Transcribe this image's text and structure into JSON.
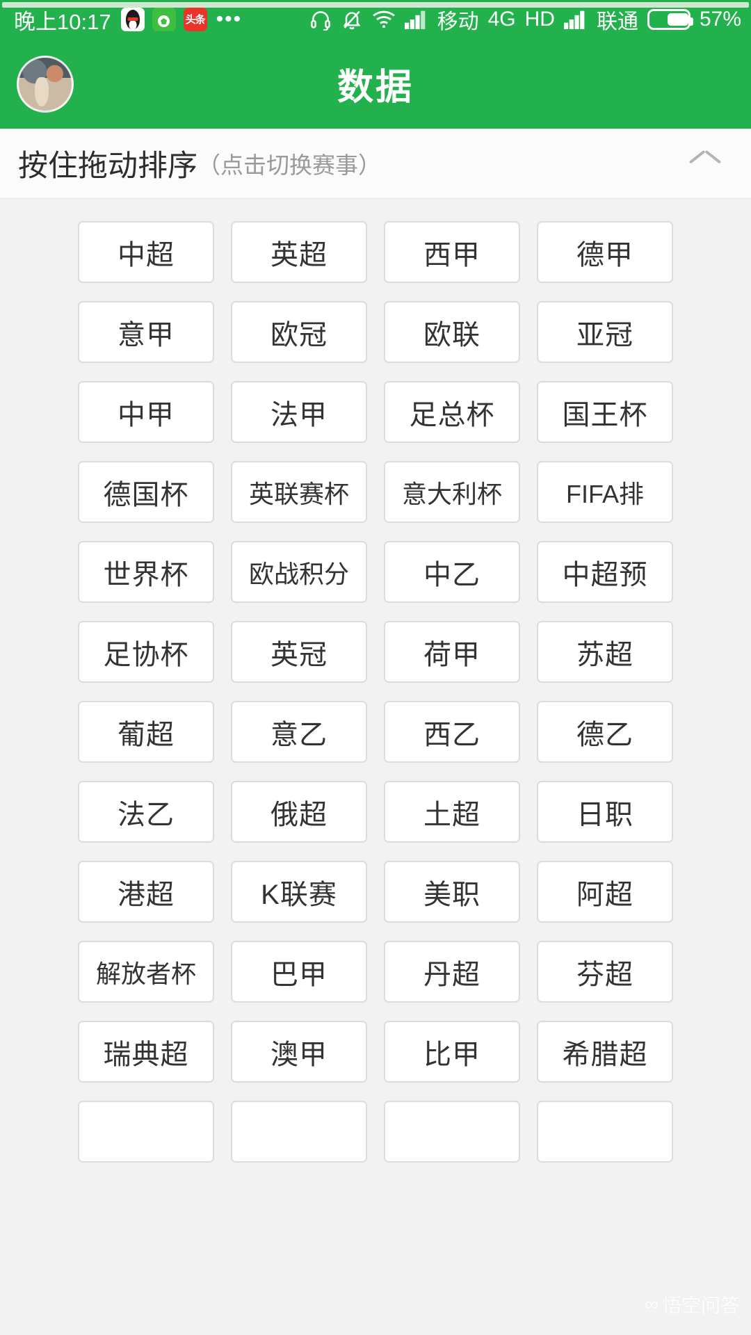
{
  "status_bar": {
    "time": "晚上10:17",
    "app_icons": [
      "qq-icon",
      "soccer-app-icon",
      "toutiao-icon"
    ],
    "overflow": "•••",
    "headset_icon": "headset-icon",
    "silent_icon": "bell-muted-icon",
    "wifi_icon": "wifi-icon",
    "signal1_icon": "signal-bars-icon",
    "carrier1": "移动",
    "network": "4G",
    "hd": "HD",
    "signal2_icon": "signal-bars-icon",
    "carrier2": "联通",
    "battery_icon": "battery-icon",
    "battery": "57%"
  },
  "app_bar": {
    "avatar": "user-avatar",
    "title": "数据"
  },
  "sort_header": {
    "main": "按住拖动排序",
    "sub": "（点击切换赛事）",
    "collapse_icon": "chevron-up-icon"
  },
  "watermark": {
    "logo": "∞",
    "text": "悟空问答"
  },
  "colors": {
    "brand_green": "#22b14c",
    "page_bg": "#f2f2f2",
    "card_bg": "#ffffff",
    "card_border": "#dcdcdc",
    "text_primary": "#333333",
    "text_muted": "#9a9a9a"
  },
  "leagues": [
    "中超",
    "英超",
    "西甲",
    "德甲",
    "意甲",
    "欧冠",
    "欧联",
    "亚冠",
    "中甲",
    "法甲",
    "足总杯",
    "国王杯",
    "德国杯",
    "英联赛杯",
    "意大利杯",
    "FIFA排",
    "世界杯",
    "欧战积分",
    "中乙",
    "中超预",
    "足协杯",
    "英冠",
    "荷甲",
    "苏超",
    "葡超",
    "意乙",
    "西乙",
    "德乙",
    "法乙",
    "俄超",
    "土超",
    "日职",
    "港超",
    "K联赛",
    "美职",
    "阿超",
    "解放者杯",
    "巴甲",
    "丹超",
    "芬超",
    "瑞典超",
    "澳甲",
    "比甲",
    "希腊超",
    "",
    "",
    "",
    ""
  ]
}
